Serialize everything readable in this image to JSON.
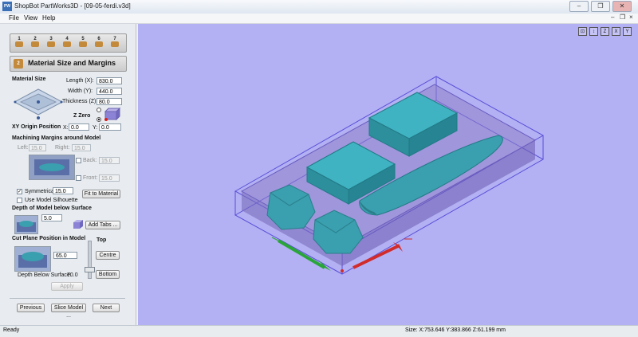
{
  "window": {
    "icon_label": "PW 3D",
    "title": "ShopBot PartWorks3D - [09-05-ferdi.v3d]",
    "minimize": "–",
    "restore": "❐",
    "close": "✕"
  },
  "menu": {
    "file": "File",
    "view": "View",
    "help": "Help"
  },
  "mdi": {
    "minimize": "–",
    "restore": "❐",
    "close": "×"
  },
  "toolbar": {
    "steps": [
      "1",
      "2",
      "3",
      "4",
      "5",
      "6",
      "7"
    ]
  },
  "section": {
    "number": "2",
    "title": "Material Size and Margins"
  },
  "material": {
    "heading": "Material Size",
    "length_label": "Length (X):",
    "length_value": "830.0",
    "width_label": "Width (Y):",
    "width_value": "440.0",
    "thickness_label": "Thickness (Z):",
    "thickness_value": "80.0",
    "zzero_label": "Z Zero"
  },
  "origin": {
    "label": "XY Origin Position",
    "x_label": "X:",
    "x_value": "0.0",
    "y_label": "Y:",
    "y_value": "0.0"
  },
  "margins": {
    "heading": "Machining Margins around Model",
    "left_label": "Left:",
    "left_value": "15.0",
    "right_label": "Right:",
    "right_value": "15.0",
    "back_label": "Back:",
    "back_value": "15.0",
    "front_label": "Front:",
    "front_value": "15.0",
    "symmetrical_label": "Symmetrical",
    "symmetrical_value": "15.0",
    "fit_button": "Fit to Material",
    "silhouette_label": "Use Model Silhouette"
  },
  "depth": {
    "heading": "Depth of Model below Surface",
    "value": "5.0",
    "add_tabs_button": "Add Tabs ..."
  },
  "cutplane": {
    "heading": "Cut Plane Position in Model",
    "top_label": "Top",
    "value": "65.0",
    "centre_button": "Centre",
    "bottom_button": "Bottom",
    "depth_label": "Depth Below Surface:",
    "depth_value": "70.0",
    "apply_button": "Apply"
  },
  "nav": {
    "previous": "Previous",
    "slice": "Slice Model ...",
    "next": "Next"
  },
  "viewport": {
    "view_icons": [
      "⊡",
      "↕",
      "Z",
      "X",
      "Y"
    ]
  },
  "status": {
    "left": "Ready",
    "size": "Size: X:753.646 Y:383.866 Z:61.199 mm"
  },
  "colors": {
    "viewport_bg": "#b3b1f3",
    "model": "#3a9fae",
    "axis_x": "#d12b2b",
    "axis_y": "#2aa53a",
    "bounding_box": "#5a4fd8"
  }
}
